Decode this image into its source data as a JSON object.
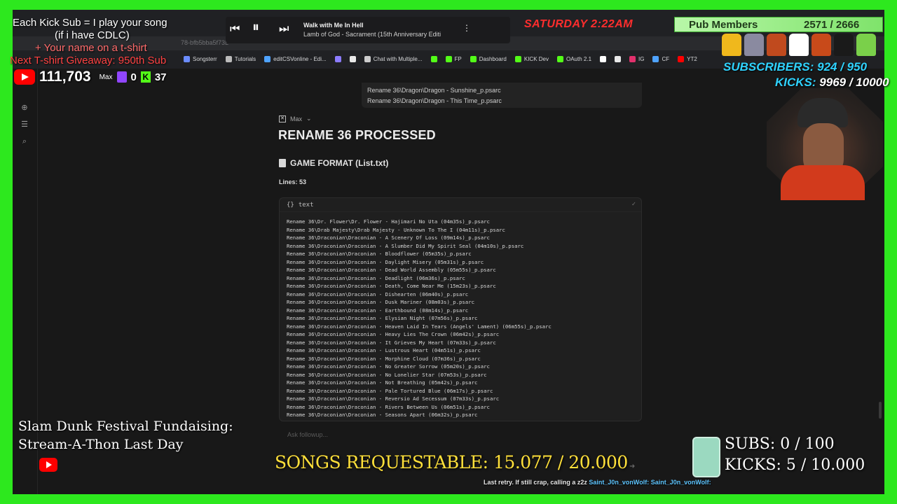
{
  "browser": {
    "url_text": "78-bfb5bba5f73L",
    "bookmarks": [
      {
        "label": "Songsterr",
        "color": "#6b8cff"
      },
      {
        "label": "Tutorials",
        "color": "#bbbbbb"
      },
      {
        "label": "editCSVonline - Edi...",
        "color": "#4fa3ff"
      },
      {
        "label": "",
        "color": "#8c7cff"
      },
      {
        "label": "",
        "color": "#e8e8e8"
      },
      {
        "label": "Chat with Multiple...",
        "color": "#cccccc"
      },
      {
        "label": "",
        "color": "#53fc18"
      },
      {
        "label": "FP",
        "color": "#53fc18"
      },
      {
        "label": "Dashboard",
        "color": "#53fc18"
      },
      {
        "label": "KICK Dev",
        "color": "#53fc18"
      },
      {
        "label": "OAuth 2.1",
        "color": "#53fc18"
      },
      {
        "label": "",
        "color": "#ffffff"
      },
      {
        "label": "",
        "color": "#e8e8e8"
      },
      {
        "label": "IG",
        "color": "#e1306c"
      },
      {
        "label": "CF",
        "color": "#4fa3ff"
      },
      {
        "label": "YT2",
        "color": "#ff0000"
      }
    ]
  },
  "dropdown": {
    "lines": [
      "Rename 36\\Dragon\\Dragon - Sunshine_p.psarc",
      "Rename 36\\Dragon\\Dragon - This Time_p.psarc"
    ]
  },
  "response": {
    "model_name": "Max",
    "heading": "RENAME 36 PROCESSED",
    "subheading": "GAME FORMAT (List.txt)",
    "lines_label": "Lines: 53",
    "code_lang": "text",
    "code_lines": [
      "Rename 36\\Dr. Flower\\Dr. Flower - Hajimari No Uta (04m35s)_p.psarc",
      "Rename 36\\Drab Majesty\\Drab Majesty - Unknown To The I (04m11s)_p.psarc",
      "Rename 36\\Draconian\\Draconian - A Scenery Of Loss (09m14s)_p.psarc",
      "Rename 36\\Draconian\\Draconian - A Slumber Did My Spirit Seal (04m10s)_p.psarc",
      "Rename 36\\Draconian\\Draconian - Bloodflower (05m35s)_p.psarc",
      "Rename 36\\Draconian\\Draconian - Daylight Misery (05m31s)_p.psarc",
      "Rename 36\\Draconian\\Draconian - Dead World Assembly (05m55s)_p.psarc",
      "Rename 36\\Draconian\\Draconian - Deadlight (06m36s)_p.psarc",
      "Rename 36\\Draconian\\Draconian - Death, Come Near Me (15m23s)_p.psarc",
      "Rename 36\\Draconian\\Draconian - Dishearten (06m40s)_p.psarc",
      "Rename 36\\Draconian\\Draconian - Dusk Mariner (08m03s)_p.psarc",
      "Rename 36\\Draconian\\Draconian - Earthbound (08m14s)_p.psarc",
      "Rename 36\\Draconian\\Draconian - Elysian Night (07m56s)_p.psarc",
      "Rename 36\\Draconian\\Draconian - Heaven Laid In Tears (Angels' Lament) (06m55s)_p.psarc",
      "Rename 36\\Draconian\\Draconian - Heavy Lies The Crown (06m42s)_p.psarc",
      "Rename 36\\Draconian\\Draconian - It Grieves My Heart (07m33s)_p.psarc",
      "Rename 36\\Draconian\\Draconian - Lustrous Heart (04m51s)_p.psarc",
      "Rename 36\\Draconian\\Draconian - Morphine Cloud (07m36s)_p.psarc",
      "Rename 36\\Draconian\\Draconian - No Greater Sorrow (05m20s)_p.psarc",
      "Rename 36\\Draconian\\Draconian - No Lonelier Star (07m53s)_p.psarc",
      "Rename 36\\Draconian\\Draconian - Not Breathing (05m42s)_p.psarc",
      "Rename 36\\Draconian\\Draconian - Pale Tortured Blue (06m17s)_p.psarc",
      "Rename 36\\Draconian\\Draconian - Reversio Ad Secessum (07m33s)_p.psarc",
      "Rename 36\\Draconian\\Draconian - Rivers Between Us (06m51s)_p.psarc",
      "Rename 36\\Draconian\\Draconian - Seasons Apart (06m32s)_p.psarc"
    ],
    "followup_placeholder": "Ask followup..."
  },
  "overlay": {
    "kick_sub_lines": [
      "Each Kick Sub = I play your song",
      "(if i have CDLC)",
      "+ Your name on a t-shirt",
      "Next T-shirt Giveaway: 950th Sub"
    ],
    "yt_subs": "111,703",
    "mx_badge": "Max",
    "twitch_count": "0",
    "kick_count": "37",
    "media": {
      "title": "Walk with Me In Hell",
      "artist": "Lamb of God - Sacrament (15th Anniversary Editi",
      "more_icon": "⋮"
    },
    "clock": "SATURDAY 2:22AM",
    "pub_members_label": "Pub Members",
    "pub_members_count": "2571 / 2666",
    "subscribers_goal_label": "SUBSCRIBERS:",
    "subscribers_goal_value": "924 / 950",
    "kicks_goal_label": "KICKS:",
    "kicks_goal_value": "9969 / 10000",
    "fundraising_line1": "Slam Dunk Festival Fundaising:",
    "fundraising_line2": "Stream-A-Thon Last Day",
    "songs_requestable": "SONGS REQUESTABLE: 15.077 / 20.000",
    "subs_goal": "SUBS:  0 / 100",
    "kicks_goal": "KICKS: 5 / 10.000",
    "ticker_text": "Last retry. If still crap, calling a z2z",
    "ticker_user1": "Saint_J0n_vonWolf:",
    "ticker_user2": "Saint_J0n_vonWolf:",
    "shirt_colors": [
      "#f0b81c",
      "#8a8aa0",
      "#c04a1e",
      "#ffffff",
      "#c84a1a",
      "#1a1a1a",
      "#7ad04a"
    ]
  }
}
